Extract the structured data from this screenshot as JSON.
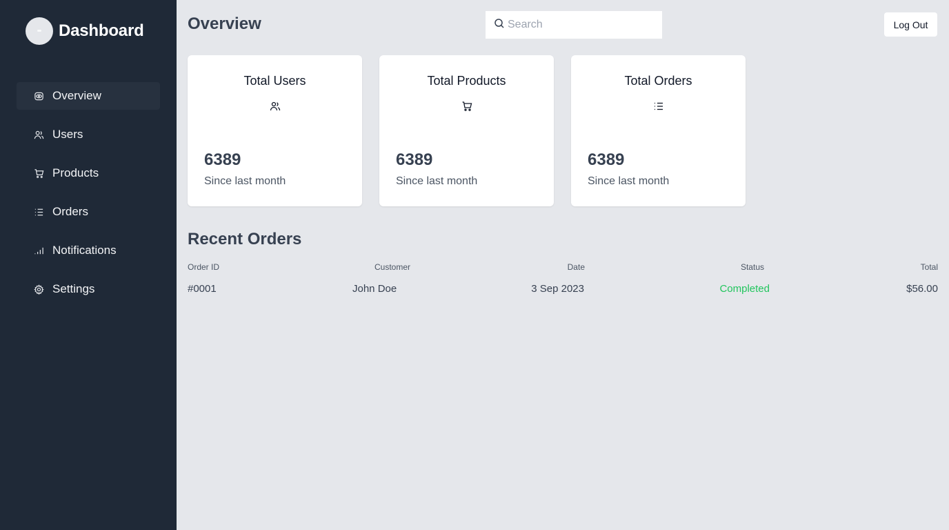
{
  "brand": {
    "title": "Dashboard"
  },
  "sidebar": {
    "items": [
      {
        "label": "Overview",
        "icon": "eye-icon",
        "active": true
      },
      {
        "label": "Users",
        "icon": "users-icon"
      },
      {
        "label": "Products",
        "icon": "cart-icon"
      },
      {
        "label": "Orders",
        "icon": "list-icon"
      },
      {
        "label": "Notifications",
        "icon": "signal-icon"
      },
      {
        "label": "Settings",
        "icon": "gear-icon"
      }
    ]
  },
  "header": {
    "title": "Overview",
    "search_placeholder": "Search",
    "logout_label": "Log Out"
  },
  "cards": [
    {
      "title": "Total Users",
      "icon": "users-icon",
      "value": "6389",
      "subtitle": "Since last month"
    },
    {
      "title": "Total Products",
      "icon": "cart-icon",
      "value": "6389",
      "subtitle": "Since last month"
    },
    {
      "title": "Total Orders",
      "icon": "list-icon",
      "value": "6389",
      "subtitle": "Since last month"
    }
  ],
  "recent_orders": {
    "title": "Recent Orders",
    "columns": [
      "Order ID",
      "Customer",
      "Date",
      "Status",
      "Total"
    ],
    "rows": [
      {
        "order_id": "#0001",
        "customer": "John Doe",
        "date": "3 Sep 2023",
        "status": "Completed",
        "total": "$56.00"
      }
    ]
  },
  "colors": {
    "sidebar_bg": "#1f2937",
    "page_bg": "#e5e7eb",
    "status_completed": "#22c55e"
  }
}
